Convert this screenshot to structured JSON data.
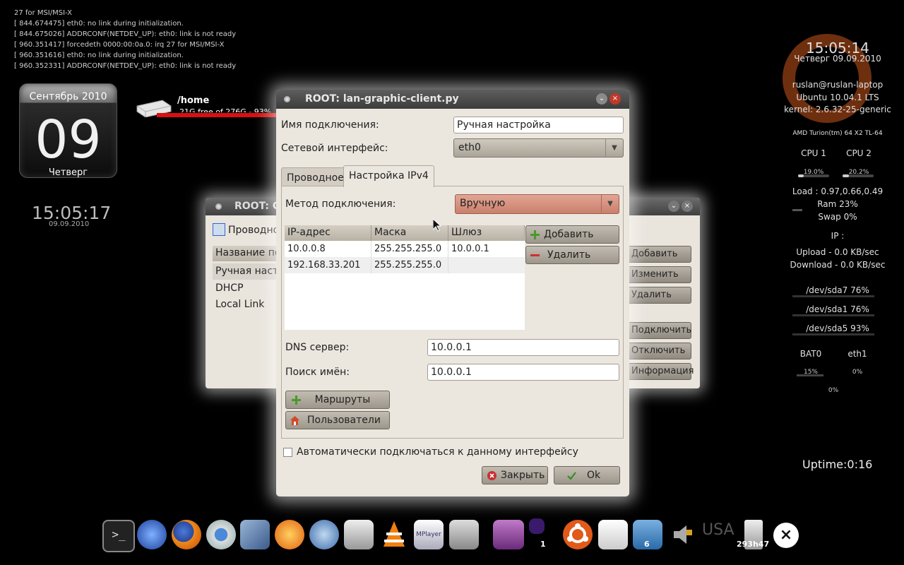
{
  "console": {
    "lines": [
      "27 for MSI/MSI-X",
      "[  844.674475] eth0: no link during initialization.",
      "[  844.675026] ADDRCONF(NETDEV_UP): eth0: link is not ready",
      "[  960.351417] forcedeth 0000:00:0a.0: irq 27 for MSI/MSI-X",
      "[  960.351616] eth0: no link during initialization.",
      "[  960.352331] ADDRCONF(NETDEV_UP): eth0: link is not ready"
    ]
  },
  "calendar": {
    "month": "Сентябрь 2010",
    "day": "09",
    "weekday": "Четверг"
  },
  "clock_left": {
    "time": "15:05:17",
    "date": "09.09.2010"
  },
  "home_drive": {
    "path": "/home",
    "free": "21G free of 276G - 93%"
  },
  "conky": {
    "time": "15:05:14",
    "date": "Четверг 09.09.2010",
    "user": "ruslan@ruslan-laptop",
    "os": "Ubuntu 10.04.1 LTS",
    "kernel": "kernel: 2.6.32-25-generic",
    "cpu_model": "AMD Turion(tm) 64 X2 TL-64",
    "cpu1_label": "CPU 1",
    "cpu2_label": "CPU 2",
    "cpu1_value": "19.0%",
    "cpu2_value": "20.2%",
    "cpu1_level": 0.19,
    "cpu2_level": 0.202,
    "load": "Load : 0.97,0.66,0.49",
    "ram": "Ram 23%",
    "swap": "Swap 0%",
    "ip": "IP :",
    "upload": "Upload - 0.0 KB/sec",
    "download": "Download - 0.0 KB/sec",
    "disks": [
      "/dev/sda7 76%",
      "/dev/sda1 76%",
      "/dev/sda5 93%"
    ],
    "bat_label": "BAT0",
    "eth_label": "eth1",
    "bat_value": "15%",
    "eth_value": "0%",
    "extra_value": "0%",
    "uptime_label": "Uptime:",
    "uptime_value": "0:16"
  },
  "bg_window": {
    "title": "ROOT: C",
    "tab_label": "Проводно",
    "list_header": "Название по",
    "list_items": [
      "Ручная наст",
      "DHCP",
      "Local Link"
    ],
    "buttons": [
      "Добавить",
      "Изменить",
      "Удалить",
      "Подключить",
      "Отключить",
      "Информация"
    ]
  },
  "dialog": {
    "title": "ROOT: lan-graphic-client.py",
    "conn_name_label": "Имя подключения:",
    "conn_name_value": "Ручная настройка",
    "iface_label": "Сетевой интерфейс:",
    "iface_value": "eth0",
    "tabs": [
      "Проводное",
      "Настройка IPv4"
    ],
    "method_label": "Метод подключения:",
    "method_value": "Вручную",
    "table": {
      "headers": [
        "IP-адрес",
        "Маска",
        "Шлюз"
      ],
      "rows": [
        [
          "10.0.0.8",
          "255.255.255.0",
          "10.0.0.1"
        ],
        [
          "192.168.33.201",
          "255.255.255.0",
          ""
        ]
      ]
    },
    "add_label": "Добавить",
    "remove_label": "Удалить",
    "dns_label": "DNS сервер:",
    "dns_value": "10.0.0.1",
    "search_label": "Поиск имён:",
    "search_value": "10.0.0.1",
    "routes_label": "Маршруты",
    "users_label": "Пользователи",
    "autoconnect_label": "Автоматически подключаться к данному интерфейсу",
    "close_label": "Закрыть",
    "ok_label": "Ok"
  },
  "dock": {
    "workspace_count": "1",
    "trash_count": "6",
    "battery_time": "293h47",
    "keyboard_layout": "USA"
  }
}
